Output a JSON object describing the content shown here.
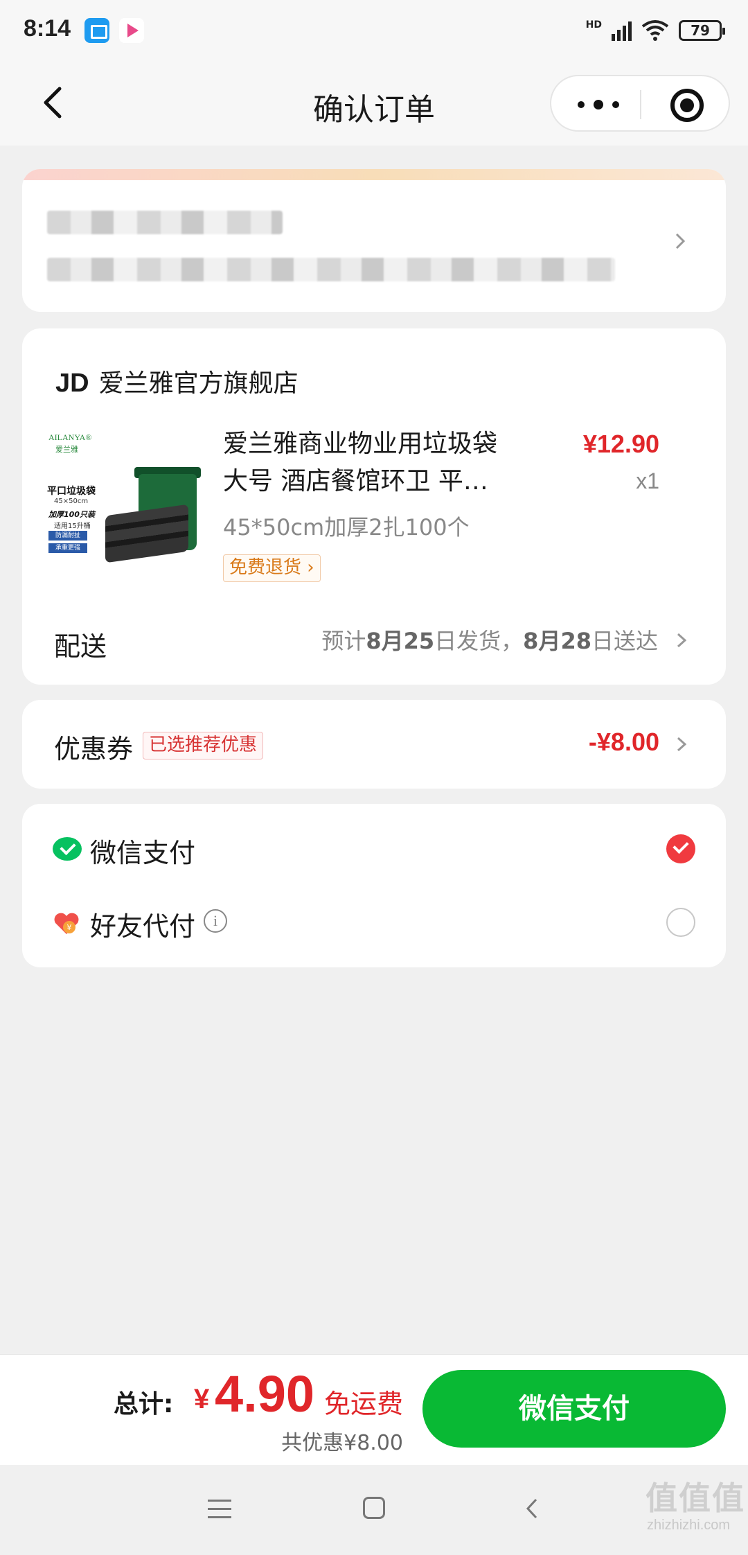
{
  "status_bar": {
    "time": "8:14",
    "network": "HD",
    "battery": "79",
    "icons": [
      "app-icon",
      "video-app-icon",
      "signal-icon",
      "wifi-icon",
      "battery-icon"
    ]
  },
  "nav": {
    "title": "确认订单",
    "icons": [
      "back-icon",
      "more-icon",
      "close-target-icon"
    ]
  },
  "address": {
    "note": ""
  },
  "shop": {
    "logo": "JD",
    "name": "爱兰雅官方旗舰店"
  },
  "product": {
    "image_text": {
      "brand": "AILANYA®",
      "brand_cn": "爱兰雅",
      "title": "平口垃圾袋",
      "size": "45×50cm",
      "thick": "加厚100只装",
      "fit": "适用15升桶",
      "tag1": "防漏耐扯",
      "tag2": "承重更强"
    },
    "title": "爱兰雅商业物业用垃圾袋 大号 酒店餐馆环卫 平…",
    "spec": "45*50cm加厚2扎100个",
    "badge": "免费退货 ›",
    "price": "¥12.90",
    "qty": "x1"
  },
  "shipping": {
    "label": "配送",
    "info_prefix": "预计",
    "info_ship_date": "8月25",
    "info_mid": "日发货，",
    "info_arrive_date": "8月28",
    "info_suffix": "日送达"
  },
  "coupon": {
    "label": "优惠券",
    "tag": "已选推荐优惠",
    "value": "-¥8.00"
  },
  "payment": {
    "options": [
      {
        "label": "微信支付",
        "icon": "wechat-pay-icon",
        "selected": true
      },
      {
        "label": "好友代付",
        "icon": "friend-pay-icon",
        "selected": false
      }
    ],
    "info_glyph": "i"
  },
  "bottom": {
    "total_label": "总计:",
    "currency": "¥",
    "total_amount": "4.90",
    "free_shipping": "免运费",
    "discount_summary": "共优惠¥8.00",
    "pay_button": "微信支付"
  },
  "watermark": {
    "logo": "值值值",
    "url": "zhizhizhi.com"
  },
  "colors": {
    "accent_red": "#e0262a",
    "wechat_green": "#09b934",
    "background": "#f0f0f0"
  }
}
